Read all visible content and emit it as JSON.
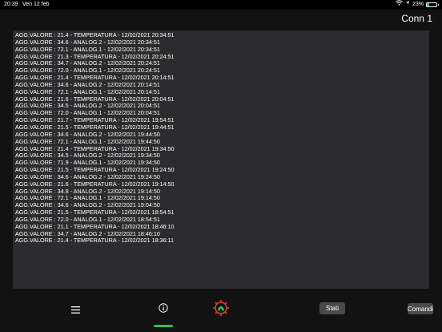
{
  "status_bar": {
    "time": "20:39",
    "date": "Ven 12 feb",
    "battery_text": "23%",
    "battery_level": 0.23
  },
  "header": {
    "title": "Conn 1"
  },
  "log": {
    "lines": [
      "AGG.VALORE : 21.4 - TEMPERATURA - 12/02/2021 20:34:51",
      "AGG.VALORE : 34.6 - ANALOG.2 - 12/02/2021 20:34:51",
      "AGG.VALORE : 72.1 - ANALOG.1 - 12/02/2021 20:34:51",
      "AGG.VALORE : 21.3 - TEMPERATURA - 12/02/2021 20:24:51",
      "AGG.VALORE : 34.7 - ANALOG.2 - 12/02/2021 20:24:51",
      "AGG.VALORE : 72.0 - ANALOG.1 - 12/02/2021 20:24:51",
      "AGG.VALORE : 21.4 - TEMPERATURA - 12/02/2021 20:14:51",
      "AGG.VALORE : 34.6 - ANALOG.2 - 12/02/2021 20:14:51",
      "AGG.VALORE : 72.1 - ANALOG.1 - 12/02/2021 20:14:51",
      "AGG.VALORE : 21.6 - TEMPERATURA - 12/02/2021 20:04:51",
      "AGG.VALORE : 34.5 - ANALOG.2 - 12/02/2021 20:04:51",
      "AGG.VALORE : 72.0 - ANALOG.1 - 12/02/2021 20:04:51",
      "AGG.VALORE : 21.7 - TEMPERATURA - 12/02/2021 19:54:51",
      "AGG.VALORE : 21.5 - TEMPERATURA - 12/02/2021 19:44:51",
      "AGG.VALORE : 34.6 - ANALOG.2 - 12/02/2021 19:44:50",
      "AGG.VALORE : 72.1 - ANALOG.1 - 12/02/2021 19:44:50",
      "AGG.VALORE : 21.4 - TEMPERATURA - 12/02/2021 19:34:50",
      "AGG.VALORE : 34.5 - ANALOG.2 - 12/02/2021 19:34:50",
      "AGG.VALORE : 71.9 - ANALOG.1 - 12/02/2021 19:34:50",
      "AGG.VALORE : 21.5 - TEMPERATURA - 12/02/2021 19:24:50",
      "AGG.VALORE : 34.6 - ANALOG.2 - 12/02/2021 19:24:50",
      "AGG.VALORE : 21.6 - TEMPERATURA - 12/02/2021 19:14:50",
      "AGG.VALORE : 34.8 - ANALOG.2 - 12/02/2021 19:14:50",
      "AGG.VALORE : 72.1 - ANALOG.1 - 12/02/2021 19:14:50",
      "AGG.VALORE : 34.6 - ANALOG.2 - 12/02/2021 19:04:50",
      "AGG.VALORE : 21.5 - TEMPERATURA - 12/02/2021 18:54:51",
      "AGG.VALORE : 72.0 - ANALOG.1 - 12/02/2021 18:54:51",
      "AGG.VALORE : 21.1 - TEMPERATURA - 12/02/2021 18:46:10",
      "AGG.VALORE : 34.7 - ANALOG.2 - 12/02/2021 18:46:10",
      "AGG.VALORE : 21.4 - TEMPERATURA - 12/02/2021 18:36:11"
    ]
  },
  "tabbar": {
    "menu_icon": "hamburger-menu-icon",
    "info_icon": "info-circle-icon",
    "logo_icon": "gear-home-logo-icon",
    "active_tab_color": "#30c050",
    "stati_label": "Stati",
    "comandi_label": "Comandi"
  }
}
